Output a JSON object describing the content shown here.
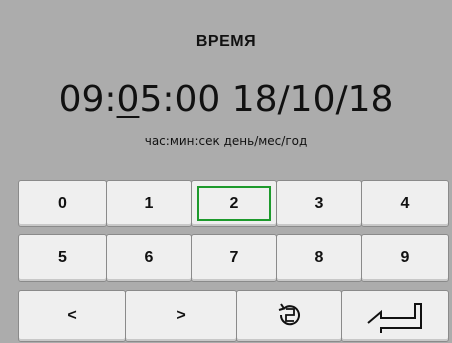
{
  "screen": {
    "title": "ВРЕМЯ",
    "time_value": {
      "before_cursor": "09:",
      "cursor_digit": "0",
      "after_cursor": "5:00 18/10/18"
    },
    "format_hint": "час:мин:сек день/мес/год",
    "selected_key": "2"
  },
  "keypad": {
    "row1": [
      "0",
      "1",
      "2",
      "3",
      "4"
    ],
    "row2": [
      "5",
      "6",
      "7",
      "8",
      "9"
    ],
    "nav": {
      "left": "<",
      "right": ">",
      "reset_icon": "reset-icon",
      "enter_icon": "enter-icon"
    }
  },
  "colors": {
    "background": "#acacac",
    "key_face": "#efefef",
    "focus": "#1d9a2c"
  }
}
